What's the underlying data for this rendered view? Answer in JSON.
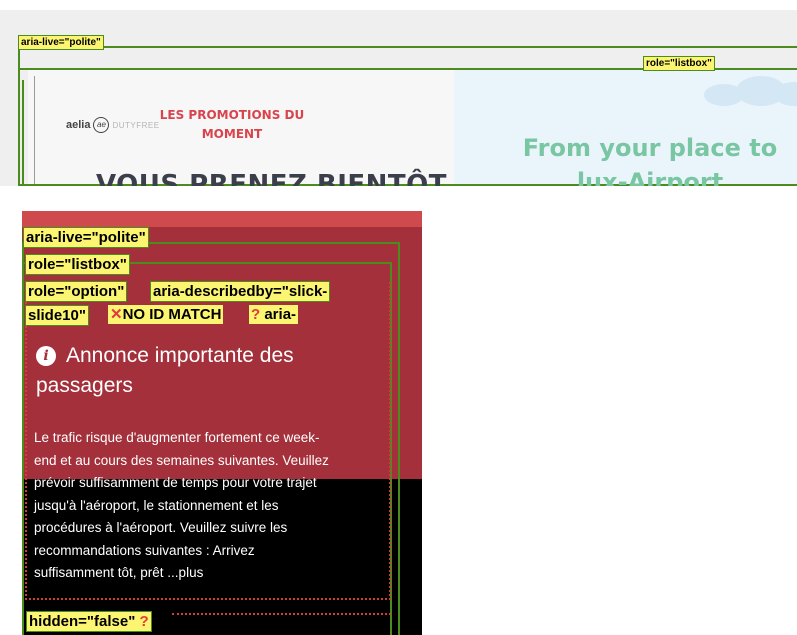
{
  "top": {
    "aria_live_tag": "aria-live=\"polite\"",
    "listbox_tag": "role=\"listbox\"",
    "logo": {
      "brand": "aelia",
      "mark": "ae",
      "suffix": "DUTYFREE"
    },
    "promo_lines": [
      "LES PROMOTIONS DU",
      "MOMENT"
    ],
    "headline": "VOUS PRENEZ BIENTÔT",
    "right_lines": [
      "From your place to",
      "lux-Airport"
    ],
    "colors": {
      "promo": "#d9434d",
      "headline": "#3a3f4b",
      "right": "#79c6a3",
      "outline": "#4c8c1e",
      "tag_bg": "#fbf572"
    }
  },
  "bottom": {
    "aria_live_tag": "aria-live=\"polite\"",
    "listbox_tag": "role=\"listbox\"",
    "option_tag": "role=\"option\"",
    "describedby_tag_line1": "aria-describedby=\"slick-",
    "describedby_tag_line2": "slide10\"",
    "no_id_match": "NO ID MATCH",
    "no_id_icon": "✕",
    "question_icon": "?",
    "aria_trunc": "aria-",
    "info_icon": "i",
    "heading_line1": "Annonce importante des",
    "heading_line2": "passagers",
    "body_lines": [
      "Le trafic risque d'augmenter fortement ce week-",
      "end et au cours des semaines suivantes. Veuillez",
      "prévoir suffisamment de temps pour votre trajet",
      "jusqu'à l'aéroport, le stationnement et les",
      "procédures à l'aéroport. Veuillez suivre les",
      "recommandations suivantes : Arrivez",
      "suffisamment tôt, prêt ...plus"
    ],
    "hidden_tag": "hidden=\"false\"",
    "colors": {
      "red_top": "#cf4a4c",
      "red_main": "#a3303a",
      "dark": "#000000",
      "warn": "#e23a3a"
    }
  }
}
